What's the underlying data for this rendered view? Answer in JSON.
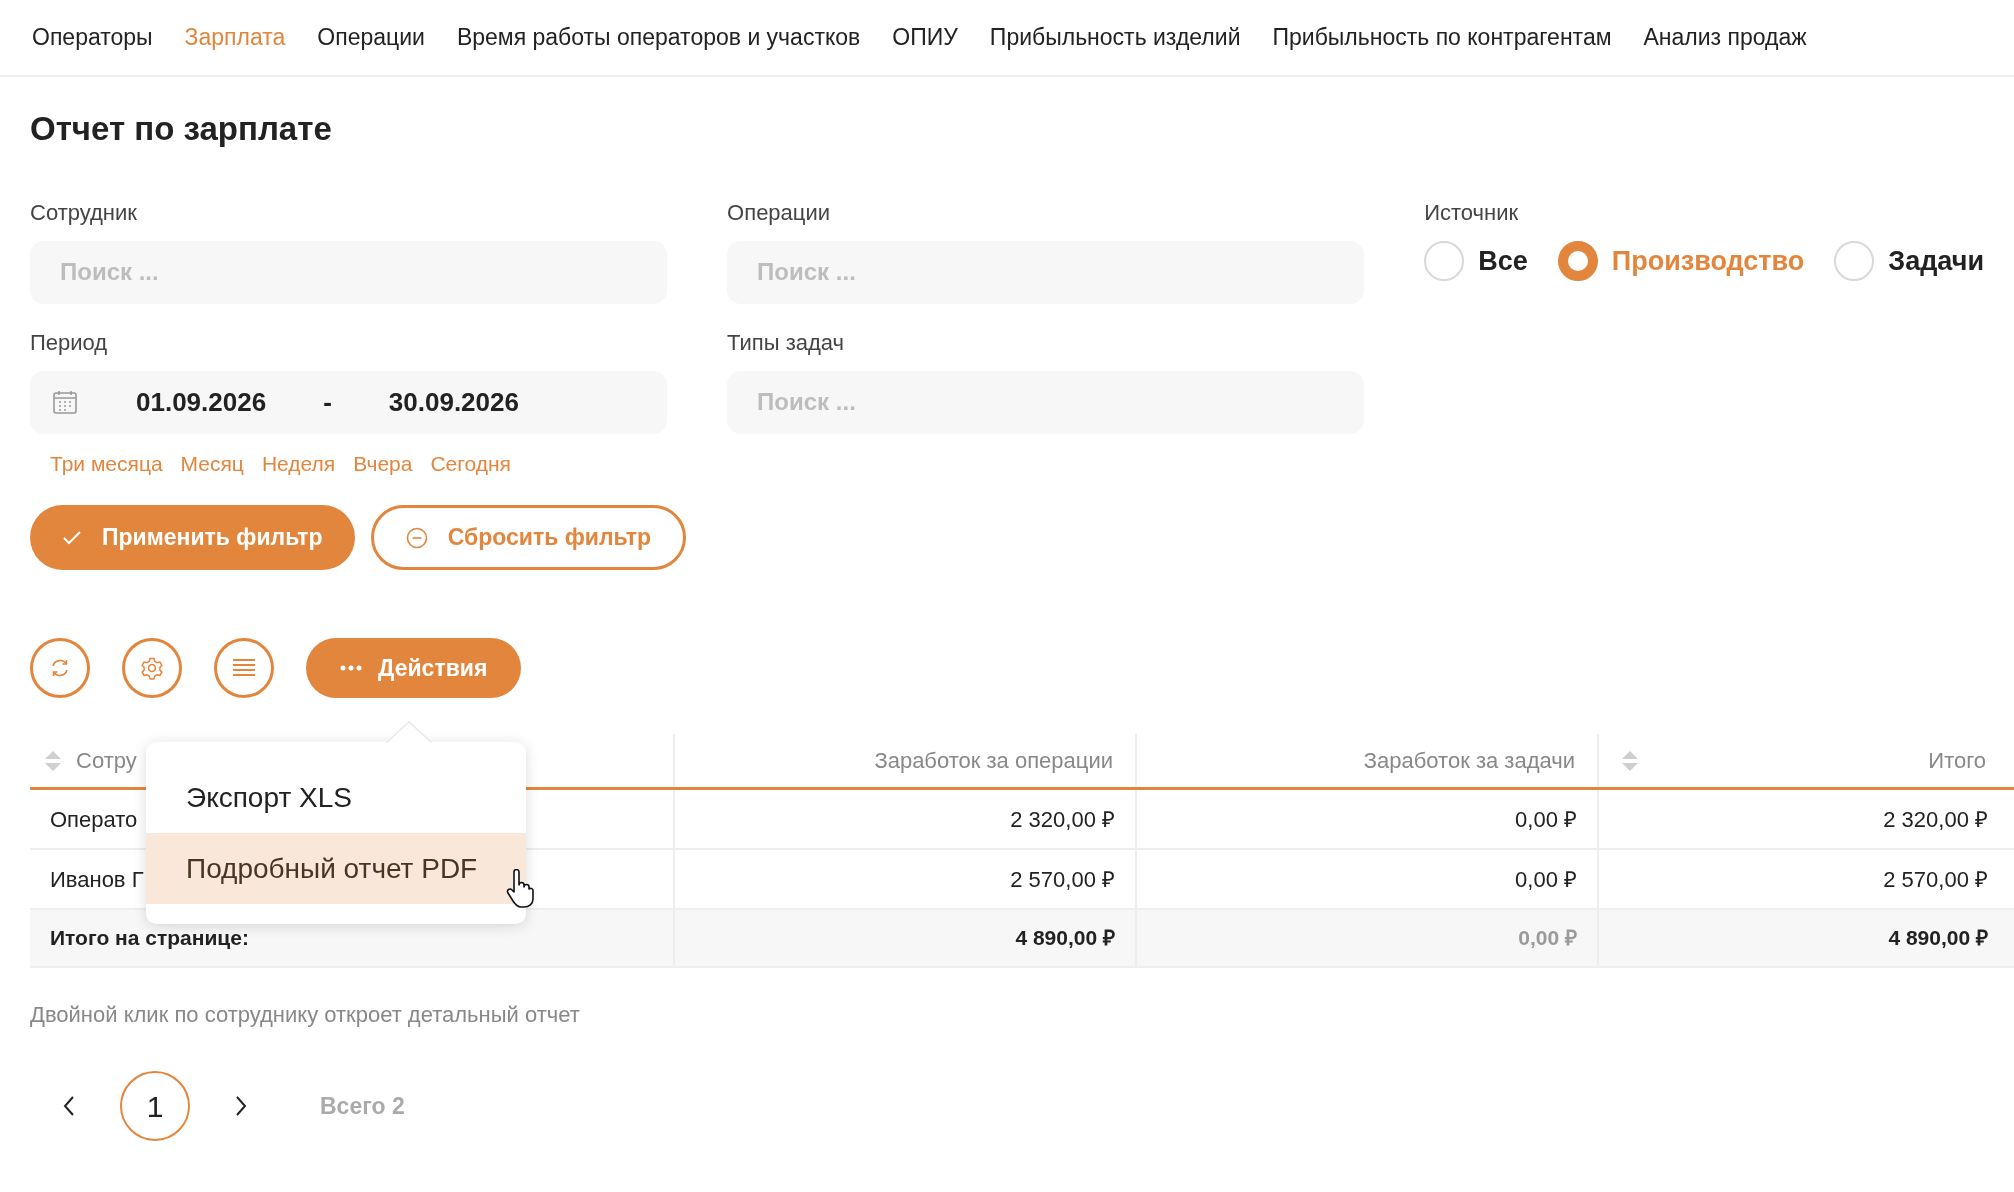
{
  "nav": [
    {
      "label": "Операторы",
      "selected": false
    },
    {
      "label": "Зарплата",
      "selected": true
    },
    {
      "label": "Операции",
      "selected": false
    },
    {
      "label": "Время работы операторов и участков",
      "selected": false
    },
    {
      "label": "ОПИУ",
      "selected": false
    },
    {
      "label": "Прибыльность изделий",
      "selected": false
    },
    {
      "label": "Прибыльность по контрагентам",
      "selected": false
    },
    {
      "label": "Анализ продаж",
      "selected": false
    }
  ],
  "title": "Отчет по зарплате",
  "filters": {
    "employee": {
      "label": "Сотрудник",
      "placeholder": "Поиск ..."
    },
    "operations": {
      "label": "Операции",
      "placeholder": "Поиск ..."
    },
    "period": {
      "label": "Период",
      "from": "01.09.2026",
      "separator": "-",
      "to": "30.09.2026"
    },
    "task_types": {
      "label": "Типы задач",
      "placeholder": "Поиск ..."
    },
    "source": {
      "label": "Источник",
      "options": [
        {
          "label": "Все",
          "selected": false
        },
        {
          "label": "Производство",
          "selected": true
        },
        {
          "label": "Задачи",
          "selected": false
        }
      ]
    },
    "quick_periods": [
      "Три месяца",
      "Месяц",
      "Неделя",
      "Вчера",
      "Сегодня"
    ]
  },
  "buttons": {
    "apply": "Применить фильтр",
    "reset": "Сбросить фильтр",
    "actions": "Действия"
  },
  "actions_menu": [
    {
      "label": "Экспорт XLS",
      "hovered": false
    },
    {
      "label": "Подробный отчет PDF",
      "hovered": true
    }
  ],
  "table": {
    "columns": [
      {
        "label": "Сотру",
        "sortable": true
      },
      {
        "label": "Заработок за операции",
        "sortable": false
      },
      {
        "label": "Заработок за задачи",
        "sortable": false
      },
      {
        "label": "Итого",
        "sortable": true
      }
    ],
    "rows": [
      [
        "Операто",
        "2 320,00 ₽",
        "0,00 ₽",
        "2 320,00 ₽"
      ],
      [
        "Иванов Г",
        "2 570,00 ₽",
        "0,00 ₽",
        "2 570,00 ₽"
      ]
    ],
    "total": [
      {
        "text": "Итого на странице:",
        "muted": false
      },
      {
        "text": "4 890,00 ₽",
        "muted": false
      },
      {
        "text": "0,00 ₽",
        "muted": true
      },
      {
        "text": "4 890,00 ₽",
        "muted": false
      }
    ]
  },
  "hint": "Двойной клик по сотруднику откроет детальный отчет",
  "pagination": {
    "pages": [
      {
        "label": "1",
        "selected": true
      }
    ],
    "total": "Всего 2"
  }
}
